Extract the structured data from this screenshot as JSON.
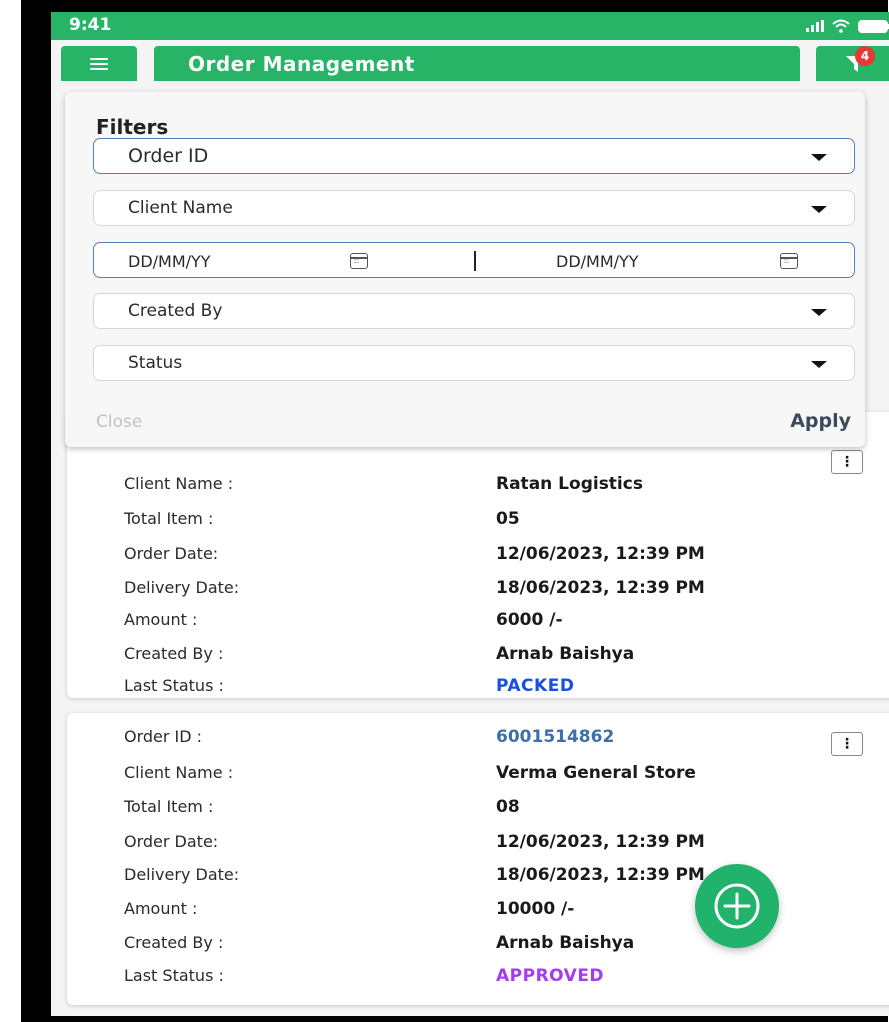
{
  "status_bar": {
    "time": "9:41"
  },
  "header": {
    "title": "Order Management",
    "filter_badge": "4"
  },
  "filters": {
    "heading": "Filters",
    "order_id": "Order ID",
    "client_name": "Client Name",
    "date_from": "DD/MM/YY",
    "date_to": "DD/MM/YY",
    "created_by": "Created By",
    "status": "Status",
    "close_label": "Close",
    "apply_label": "Apply"
  },
  "labels": {
    "order_id": "Order ID :",
    "client_name": "Client Name :",
    "total_item": "Total Item :",
    "order_date": "Order Date:",
    "delivery_date": "Delivery Date:",
    "amount": "Amount :",
    "created_by": "Created By :",
    "last_status": "Last Status :"
  },
  "orders": [
    {
      "client_name": "Ratan Logistics",
      "total_item": "05",
      "order_date": "12/06/2023, 12:39 PM",
      "delivery_date": "18/06/2023, 12:39 PM",
      "amount": "6000 /-",
      "created_by": "Arnab Baishya",
      "last_status": "PACKED"
    },
    {
      "order_id": "6001514862",
      "client_name": "Verma General Store",
      "total_item": "08",
      "order_date": "12/06/2023, 12:39 PM",
      "delivery_date": "18/06/2023, 12:39 PM",
      "amount": "10000 /-",
      "created_by": "Arnab Baishya",
      "last_status": "APPROVED"
    }
  ],
  "colors": {
    "primary": "#27b466",
    "status_packed": "#1a4fe0",
    "status_approved": "#a43cf0",
    "link": "#3d6fa8",
    "badge": "#e53935"
  },
  "icons": {
    "menu": "hamburger-icon",
    "filter": "filter-funnel-icon",
    "calendar": "calendar-icon",
    "dropdown": "caret-down-icon",
    "more": "kebab-menu-icon",
    "add": "add-circle-icon"
  }
}
